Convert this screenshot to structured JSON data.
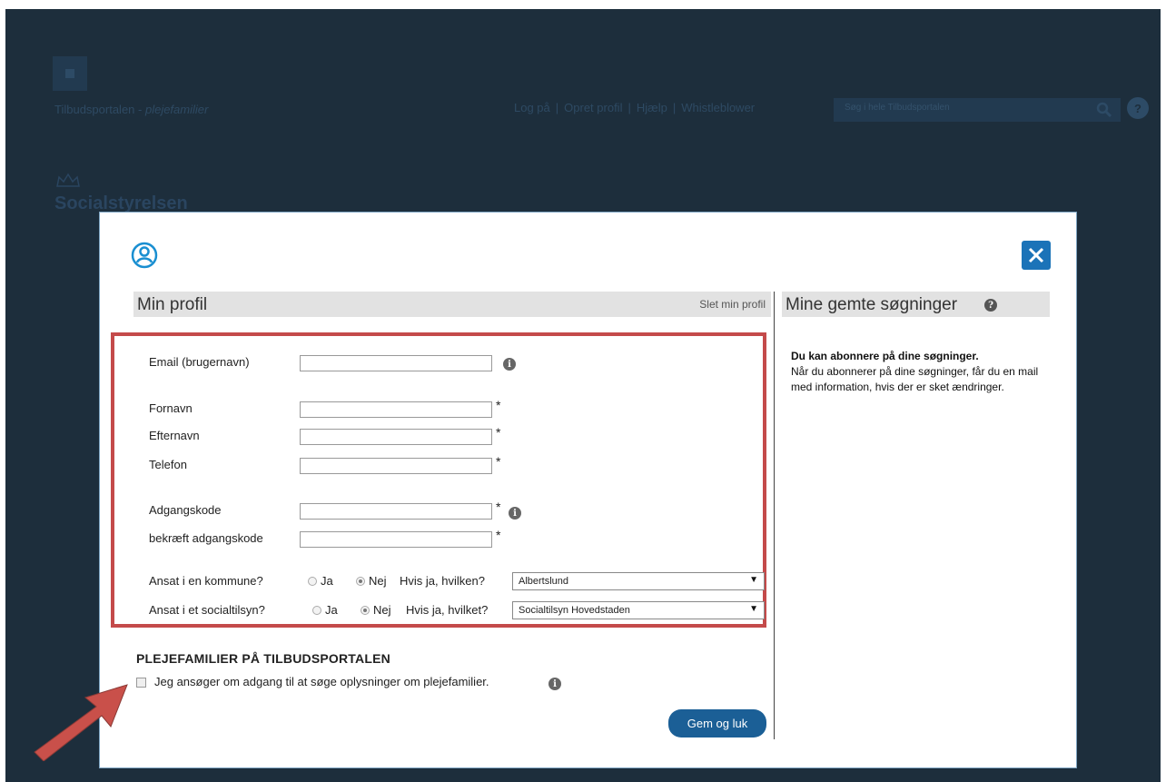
{
  "background": {
    "site_title": "Tilbudsportalen - ",
    "site_title_em": "plejefamilier",
    "nav": [
      "Log på",
      "Opret profil",
      "Hjælp",
      "Whistleblower"
    ],
    "search_placeholder": "Søg i hele Tilbudsportalen",
    "brand": "Socialstyrelsen",
    "help_glyph": "?"
  },
  "modal": {
    "close_glyph": "✕",
    "profile": {
      "title": "Min profil",
      "delete_link": "Slet min profil",
      "fields": {
        "email_label": "Email (brugernavn)",
        "firstname_label": "Fornavn",
        "lastname_label": "Efternavn",
        "phone_label": "Telefon",
        "password_label": "Adgangskode",
        "confirm_label": "bekræft adgangskode",
        "required_mark": "*",
        "info_glyph": "i"
      },
      "kommune": {
        "label": "Ansat i en kommune?",
        "yes": "Ja",
        "no": "Nej",
        "which_label": "Hvis ja, hvilken?",
        "selected": "Albertslund",
        "selected_option": "no"
      },
      "socialtilsyn": {
        "label": "Ansat i et socialtilsyn?",
        "yes": "Ja",
        "no": "Nej",
        "which_label": "Hvis ja, hvilket?",
        "selected": "Socialtilsyn Hovedstaden",
        "selected_option": "no"
      },
      "plejefamilier": {
        "heading": "PLEJEFAMILIER PÅ TILBUDSPORTALEN",
        "checkbox_label": "Jeg ansøger om adgang til at søge oplysninger om plejefamilier.",
        "checked": false
      },
      "save_label": "Gem og luk"
    },
    "saved_searches": {
      "title": "Mine gemte søgninger",
      "help_glyph": "?",
      "bold_text": "Du kan abonnere på dine søgninger.",
      "text": "Når du abonnerer på dine søgninger, får du en mail med information, hvis der er sket ændringer."
    }
  },
  "colors": {
    "backdrop": "#1d2e3c",
    "accent": "#1b73b8",
    "highlight_box": "#c44a4a",
    "arrow": "#c9504a"
  }
}
